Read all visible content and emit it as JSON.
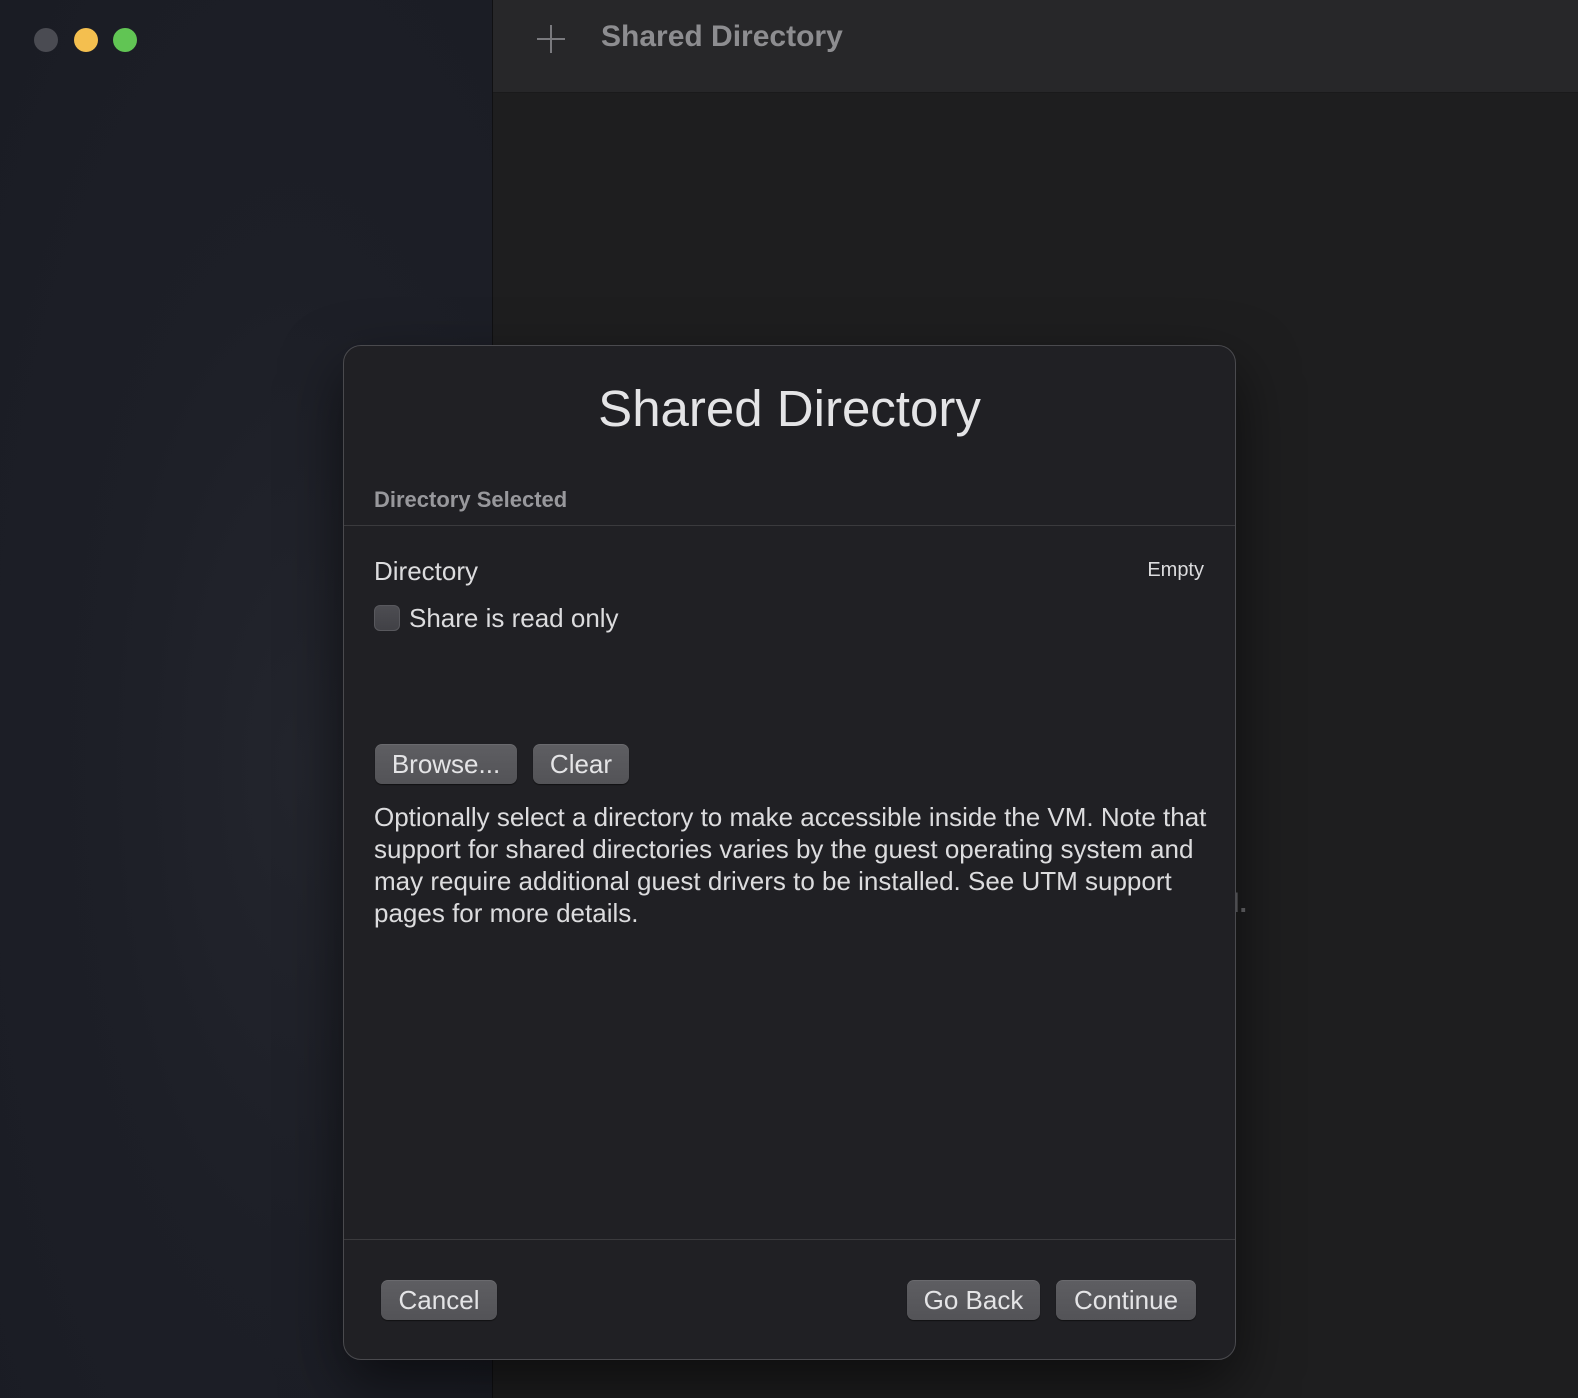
{
  "window": {
    "title": "Shared Directory",
    "background_text": "ved."
  },
  "sheet": {
    "title": "Shared Directory",
    "section_header": "Directory Selected",
    "directory_label": "Directory",
    "directory_value": "Empty",
    "read_only_label": "Share is read only",
    "read_only_checked": false,
    "browse_label": "Browse...",
    "clear_label": "Clear",
    "description": "Optionally select a directory to make accessible inside the VM. Note that support for shared directories varies by the guest operating system and may require additional guest drivers to be installed. See UTM support pages for more details.",
    "cancel_label": "Cancel",
    "go_back_label": "Go Back",
    "continue_label": "Continue"
  },
  "colors": {
    "traffic_close": "#4a4b52",
    "traffic_minimize": "#f4bf4f",
    "traffic_maximize": "#61c554"
  },
  "icons": {
    "add": "plus-icon"
  }
}
